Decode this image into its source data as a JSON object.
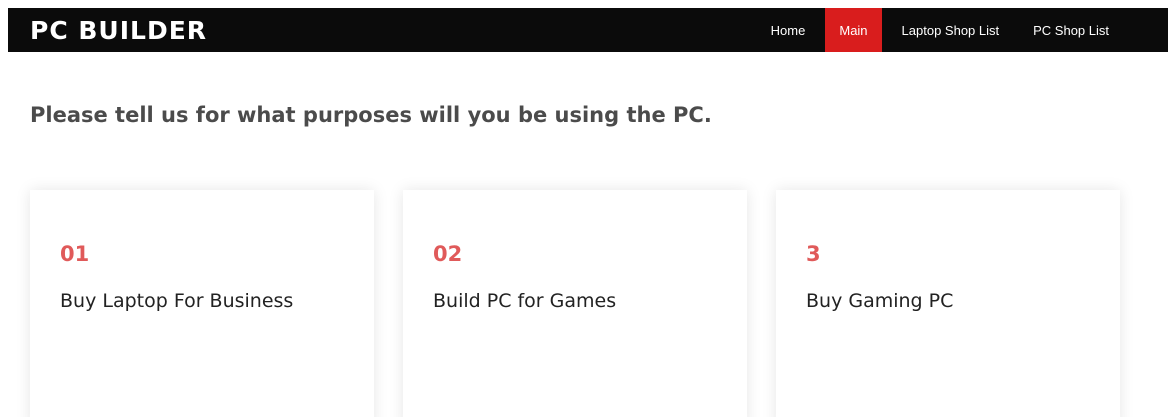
{
  "brand": "PC BUILDER",
  "nav": {
    "items": [
      {
        "label": "Home",
        "active": false
      },
      {
        "label": "Main",
        "active": true
      },
      {
        "label": "Laptop Shop List",
        "active": false
      },
      {
        "label": "PC Shop List",
        "active": false
      }
    ]
  },
  "heading": "Please tell us for what purposes will you be using the PC.",
  "cards": [
    {
      "number": "01",
      "title": "Buy Laptop For Business"
    },
    {
      "number": "02",
      "title": "Build PC for Games"
    },
    {
      "number": "3",
      "title": "Buy Gaming PC"
    }
  ],
  "colors": {
    "navbar_bg": "#0b0b0b",
    "accent": "#d91d1d",
    "card_number": "#e05a5a"
  }
}
